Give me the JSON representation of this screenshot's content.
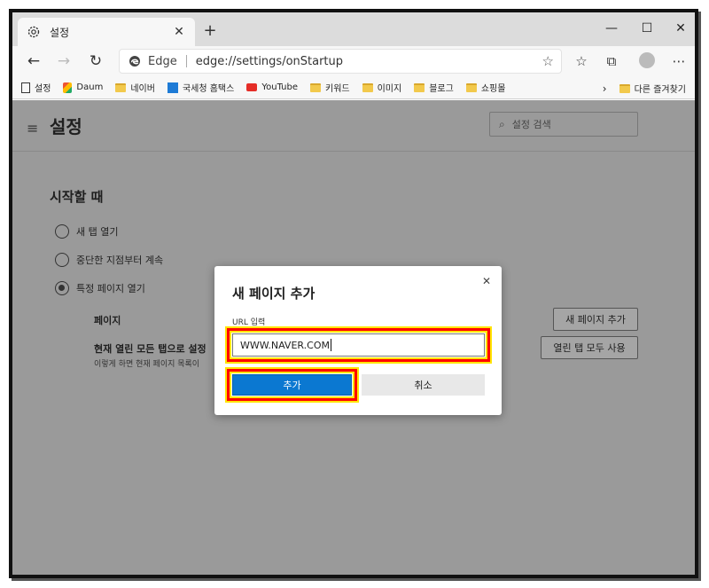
{
  "tab": {
    "title": "설정"
  },
  "window": {
    "minimize": "—",
    "maximize": "☐",
    "close": "✕"
  },
  "address": {
    "brand": "Edge",
    "url": "edge://settings/onStartup"
  },
  "bookmarks": [
    {
      "label": "설정",
      "icon": "page-icon"
    },
    {
      "label": "Daum",
      "icon": "daum-icon"
    },
    {
      "label": "네이버",
      "icon": "folder-icon"
    },
    {
      "label": "국세청 홈택스",
      "icon": "hometax-icon"
    },
    {
      "label": "YouTube",
      "icon": "youtube-icon"
    },
    {
      "label": "키워드",
      "icon": "folder-icon"
    },
    {
      "label": "이미지",
      "icon": "folder-icon"
    },
    {
      "label": "블로그",
      "icon": "folder-icon"
    },
    {
      "label": "쇼핑몰",
      "icon": "folder-icon"
    }
  ],
  "bookmarks_other": "다른 즐겨찾기",
  "settings": {
    "title": "설정",
    "search_placeholder": "설정 검색",
    "section_title": "시작할 때",
    "options": [
      "새 탭 열기",
      "중단한 지점부터 계속",
      "특정 페이지 열기"
    ],
    "selected_option": "특정 페이지 열기",
    "pages_label": "페이지",
    "add_page_button": "새 페이지 추가",
    "replace_label": "현재 열린 모든 탭으로 설정",
    "replace_desc": "이렇게 하면 현재 페이지 목록이",
    "use_all_tabs_button": "열린 탭 모두 사용"
  },
  "dialog": {
    "title": "새 페이지 추가",
    "url_label": "URL 입력",
    "url_value": "WWW.NAVER.COM",
    "add_button": "추가",
    "cancel_button": "취소"
  },
  "colors": {
    "primary": "#0b78d1",
    "highlight": "#ff0000",
    "highlight_glow": "#ffe400",
    "overlay": "#9a9a9a"
  }
}
